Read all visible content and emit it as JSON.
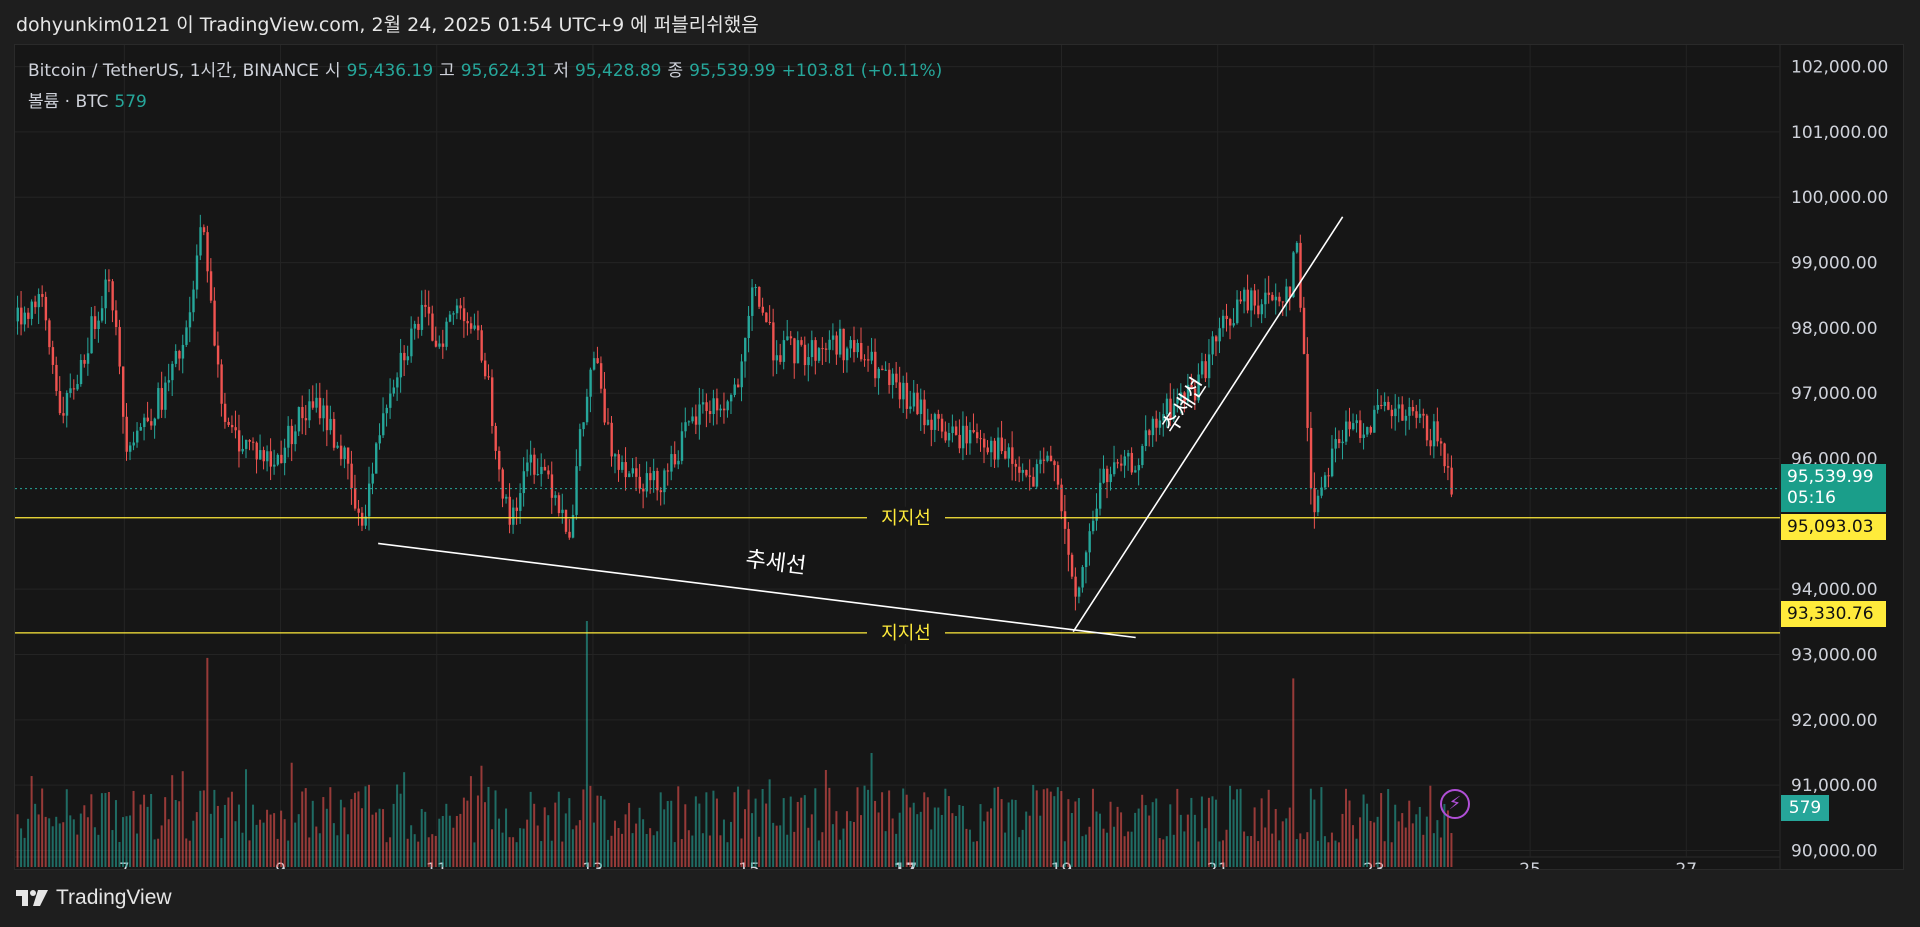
{
  "header": {
    "publish_line": "dohyunkim0121 이 TradingView.com, 2월 24, 2025 01:54 UTC+9 에 퍼블리쉬했음"
  },
  "legend": {
    "symbol": "Bitcoin / TetherUS, 1시간, BINANCE",
    "open_label": "시",
    "open": "95,436.19",
    "high_label": "고",
    "high": "95,624.31",
    "low_label": "저",
    "low": "95,428.89",
    "close_label": "종",
    "close": "95,539.99",
    "change": "+103.81 (+0.11%)",
    "volume_label": "볼륨 · BTC",
    "volume": "579"
  },
  "badges": {
    "last_price": "95,539.99",
    "countdown": "05:16",
    "level1": "95,093.03",
    "level2": "93,330.76",
    "volume": "579"
  },
  "footer": {
    "brand": "TradingView"
  },
  "colors": {
    "up": "#26a69a",
    "down": "#ef5350",
    "level": "#ffeb3b",
    "trendline": "#ffffff",
    "background": "#161616"
  },
  "chart_data": {
    "type": "candlestick",
    "title": "Bitcoin / TetherUS, 1시간, BINANCE",
    "ylim": [
      89900,
      102300
    ],
    "y_ticks": [
      "102,000.00",
      "101,000.00",
      "100,000.00",
      "99,000.00",
      "98,000.00",
      "97,000.00",
      "96,000.00",
      "94,000.00",
      "93,000.00",
      "92,000.00",
      "91,000.00",
      "90,000.00"
    ],
    "y_tick_values": [
      102000,
      101000,
      100000,
      99000,
      98000,
      97000,
      96000,
      94000,
      93000,
      92000,
      91000,
      90000
    ],
    "x_ticks": [
      "7",
      "9",
      "11",
      "13",
      "15",
      "17",
      "19",
      "21",
      "23",
      "25",
      "27"
    ],
    "x_tick_values": [
      7,
      9,
      11,
      13,
      15,
      17,
      19,
      21,
      23,
      25,
      27
    ],
    "x_bold_ticks": [
      "17"
    ],
    "x_range": [
      5.6,
      28.2
    ],
    "series": [
      {
        "x": [
          5.6,
          5.9,
          6.2,
          6.5,
          6.8,
          7.0,
          7.2,
          7.5,
          7.8,
          8.0,
          8.05,
          8.3,
          8.6,
          8.9,
          9.2,
          9.5,
          9.8,
          10.0,
          10.2,
          10.3,
          10.5,
          10.8,
          11.0,
          11.3,
          11.6,
          11.9,
          12.2,
          12.4,
          12.7,
          12.8,
          13.0,
          13.2,
          13.5,
          13.8,
          14.1,
          14.4,
          14.7,
          14.9,
          15.05,
          15.3,
          15.7,
          16.1,
          16.5,
          16.8,
          17.2,
          17.6,
          17.9,
          18.2,
          18.6,
          18.9,
          19.15,
          19.5,
          19.9,
          20.3,
          20.7,
          21.0,
          21.3,
          21.6,
          21.9,
          22.0,
          22.2,
          22.5,
          22.8,
          23.1,
          23.5,
          23.8,
          24.0
        ],
        "close": [
          98100,
          98500,
          96600,
          97700,
          98900,
          96300,
          96500,
          97000,
          97900,
          99800,
          98700,
          96400,
          96200,
          95900,
          96600,
          96800,
          96000,
          94900,
          96000,
          96800,
          97500,
          98200,
          97800,
          98400,
          97500,
          95000,
          96000,
          95800,
          94900,
          96100,
          97600,
          96200,
          95800,
          95600,
          96200,
          96800,
          96800,
          97300,
          98700,
          97700,
          97600,
          97800,
          97500,
          97100,
          96700,
          96300,
          96400,
          96100,
          95600,
          96100,
          93700,
          95700,
          95900,
          96700,
          97100,
          97900,
          98400,
          98400,
          98600,
          99300,
          95200,
          96300,
          96500,
          96700,
          96600,
          96300,
          95540
        ]
      }
    ],
    "volume": {
      "label": "볼륨 · BTC",
      "last": 579,
      "spikes": [
        {
          "x": 8.05,
          "value": 2550
        },
        {
          "x": 12.9,
          "value": 3000
        },
        {
          "x": 21.95,
          "value": 2300
        }
      ]
    },
    "levels": [
      {
        "name": "지지선",
        "value": 95093.03
      },
      {
        "name": "지지선",
        "value": 93330.76
      }
    ],
    "last_price": 95539.99,
    "trendlines": [
      {
        "name": "추세선",
        "from": {
          "x": 10.25,
          "y": 94700
        },
        "to": {
          "x": 19.95,
          "y": 93260
        }
      },
      {
        "name": "추세선",
        "from": {
          "x": 19.15,
          "y": 93350
        },
        "to": {
          "x": 22.6,
          "y": 99700
        }
      }
    ],
    "grid": true
  }
}
